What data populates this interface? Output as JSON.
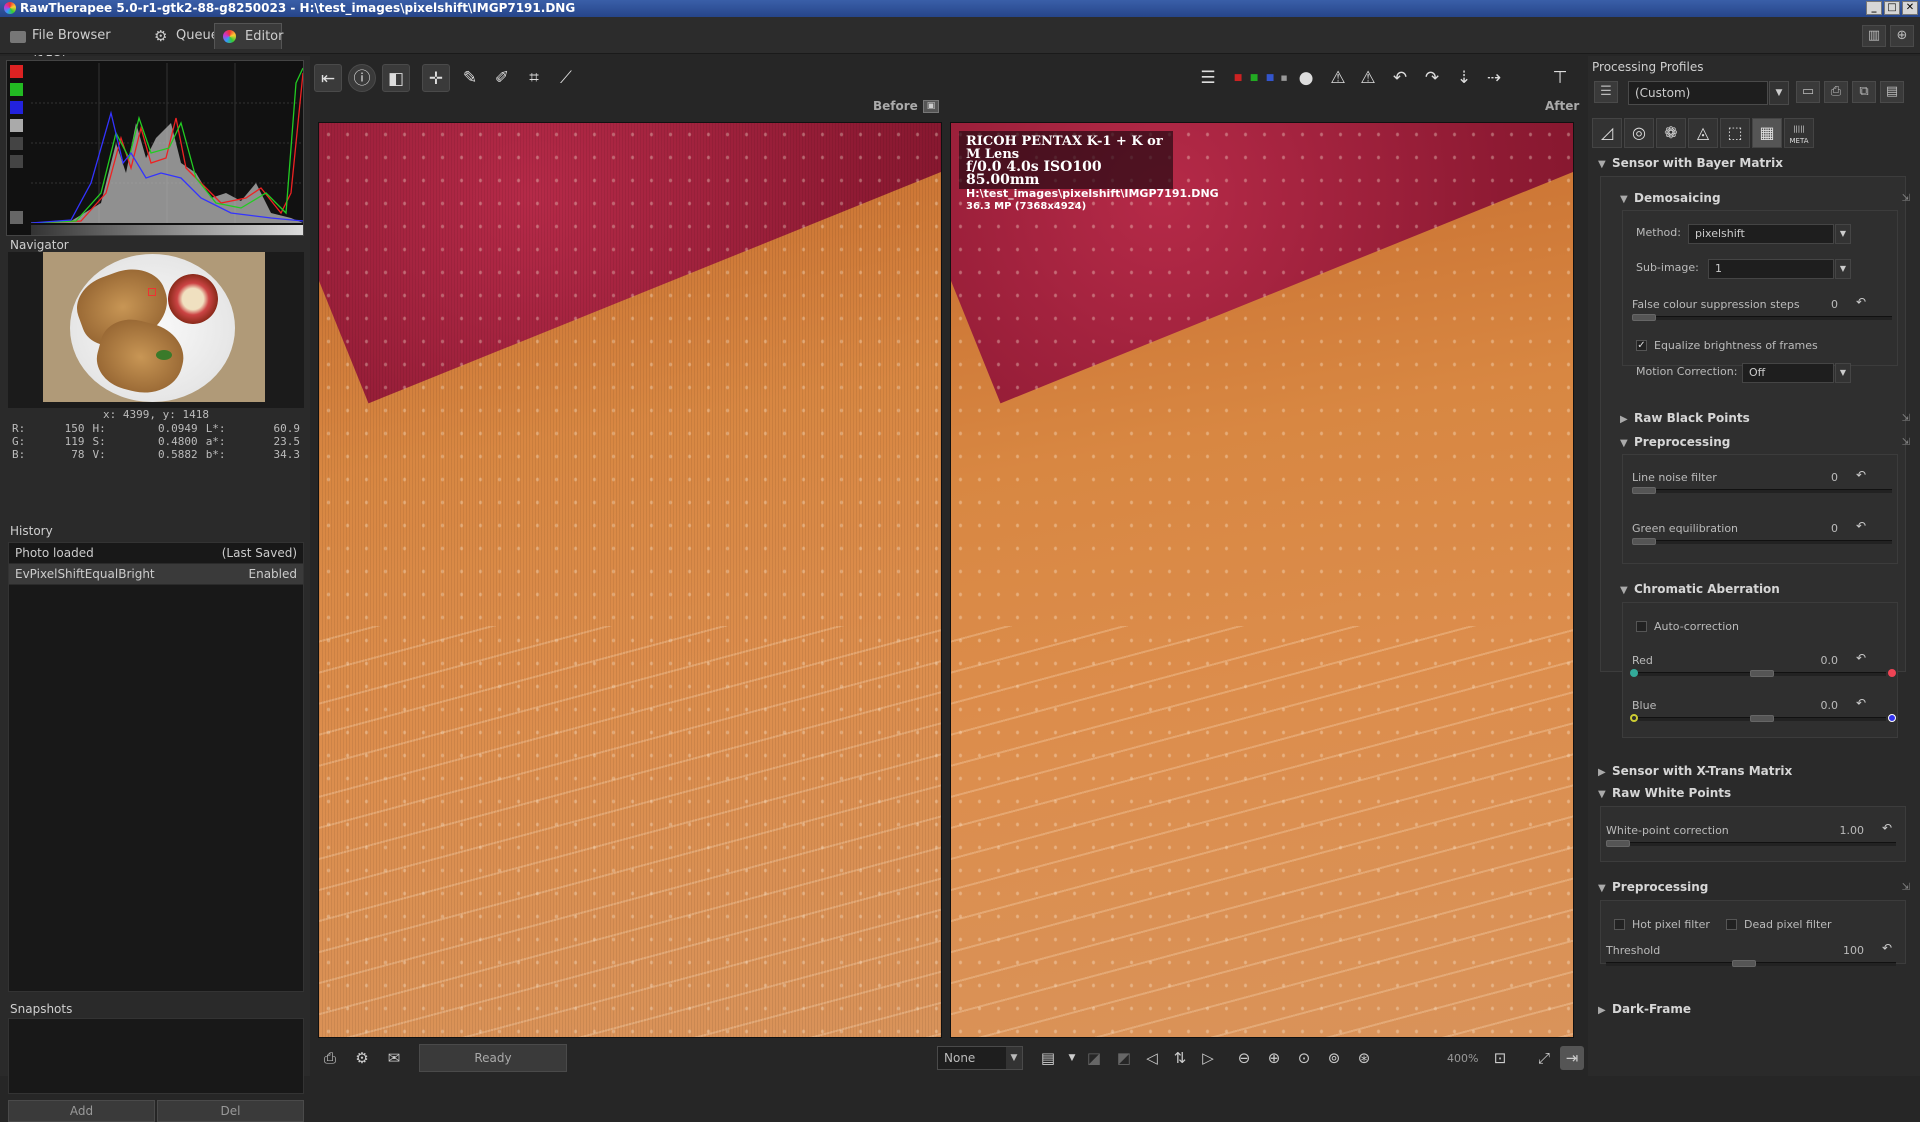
{
  "window": {
    "title": "RawTherapee 5.0-r1-gtk2-88-g8250023 - H:\\test_images\\pixelshift\\IMGP7191.DNG"
  },
  "tabs": [
    {
      "label": "File Browser (152)",
      "icon": "folder-icon"
    },
    {
      "label": "Queue",
      "icon": "gears-icon"
    },
    {
      "label": "Editor",
      "icon": "color-wheel-icon"
    }
  ],
  "navigator": {
    "title": "Navigator",
    "coords": "x: 4399, y: 1418",
    "rgb": {
      "R": "150",
      "G": "119",
      "B": "78"
    },
    "hsv": {
      "H": "0.0949",
      "S": "0.4800",
      "V": "0.5882"
    },
    "lab": {
      "L": "60.9",
      "a": "23.5",
      "b": "34.3"
    }
  },
  "history": {
    "title": "History",
    "rows": [
      {
        "name": "Photo loaded",
        "value": "(Last Saved)"
      },
      {
        "name": "EvPixelShiftEqualBright",
        "value": "Enabled"
      }
    ]
  },
  "snapshots": {
    "title": "Snapshots",
    "add": "Add",
    "del": "Del"
  },
  "preview": {
    "before": "Before",
    "after": "After",
    "exif": {
      "camera": "RICOH PENTAX K-1 + K or M Lens",
      "params": "f/0.0  4.0s  ISO100  85.00mm",
      "path": "H:\\test_images\\pixelshift\\IMGP7191.DNG",
      "size": "36.3 MP (7368x4924)"
    }
  },
  "statusbar": {
    "status": "Ready",
    "preview_select": "None",
    "zoom": "400%"
  },
  "right_panel": {
    "title": "Processing Profiles",
    "profile": "(Custom)",
    "sections": {
      "bayer": "Sensor with Bayer Matrix",
      "demosaicing": "Demosaicing",
      "method_label": "Method:",
      "method_value": "pixelshift",
      "subimage_label": "Sub-image:",
      "subimage_value": "1",
      "false_colour": "False colour suppression steps",
      "false_colour_val": "0",
      "equalize": "Equalize brightness of frames",
      "motion_label": "Motion Correction:",
      "motion_value": "Off",
      "raw_black": "Raw Black Points",
      "preprocessing": "Preprocessing",
      "line_noise": "Line noise filter",
      "line_noise_val": "0",
      "green_eq": "Green equilibration",
      "green_eq_val": "0",
      "chromatic": "Chromatic Aberration",
      "autocorrection": "Auto-correction",
      "red": "Red",
      "red_val": "0.0",
      "blue": "Blue",
      "blue_val": "0.0",
      "xtrans": "Sensor with X-Trans Matrix",
      "raw_white": "Raw White Points",
      "wp_correction": "White-point correction",
      "wp_val": "1.00",
      "preprocessing2": "Preprocessing",
      "hot_pixel": "Hot pixel filter",
      "dead_pixel": "Dead pixel filter",
      "threshold": "Threshold",
      "threshold_val": "100",
      "dark_frame": "Dark-Frame"
    },
    "tool_tabs": [
      "exposure-icon",
      "detail-icon",
      "color-icon",
      "advanced-icon",
      "transform-icon",
      "raw-icon",
      "metadata-icon"
    ],
    "meta_label": "META"
  },
  "colors": {
    "accent": "#3a5fa8",
    "jam": "#9a1f3a",
    "toast": "#d8883f"
  }
}
